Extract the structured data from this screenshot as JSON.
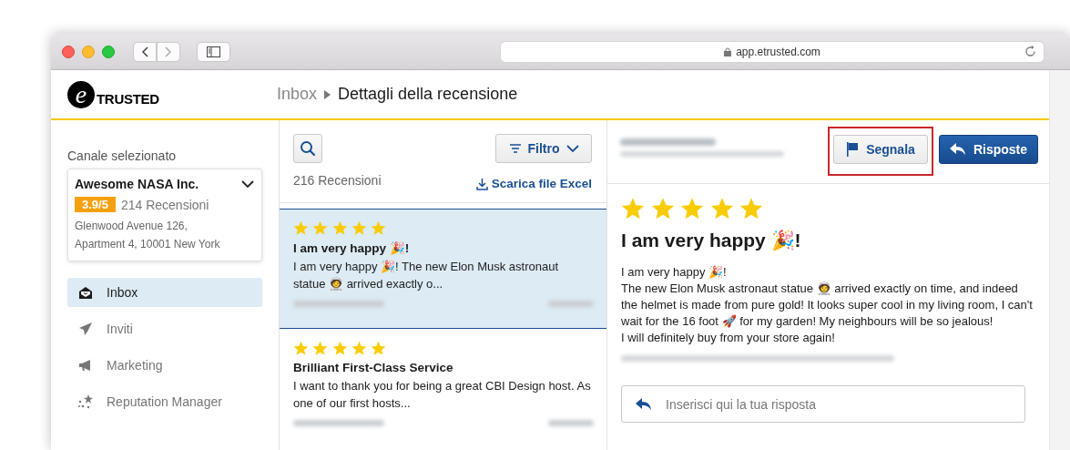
{
  "browser": {
    "url": "app.etrusted.com"
  },
  "header": {
    "logo_letter": "e",
    "logo_text": "TRUSTED",
    "breadcrumb": [
      {
        "label": "Inbox",
        "current": false
      },
      {
        "label": "Dettagli della recensione",
        "current": true
      }
    ]
  },
  "sidebar": {
    "channel_label": "Canale selezionato",
    "channel": {
      "name": "Awesome NASA Inc.",
      "rating": "3.9/5",
      "reviews": "214 Recensioni",
      "address_lines": [
        "Glenwood Avenue 126,",
        "Apartment 4, 10001 New York"
      ]
    },
    "items": [
      {
        "label": "Inbox",
        "selected": true
      },
      {
        "label": "Inviti",
        "selected": false
      },
      {
        "label": "Marketing",
        "selected": false
      },
      {
        "label": "Reputation Manager",
        "selected": false
      }
    ]
  },
  "list": {
    "filter_label": "Filtro",
    "count": "216 Recensioni",
    "download": "Scarica file Excel",
    "reviews": [
      {
        "stars": 5,
        "title": "I am very happy 🎉!",
        "excerpt": "I am very happy 🎉! The new Elon Musk astronaut statue 🧑‍🚀 arrived exactly o...",
        "selected": true
      },
      {
        "stars": 5,
        "title": "Brilliant First-Class Service",
        "excerpt": "I want to thank you for being a great CBI Design host. As one of our first hosts...",
        "selected": false
      }
    ]
  },
  "detail": {
    "flag_button": {
      "label": "Segnala",
      "highlighted": true
    },
    "reply_button": "Risposte",
    "stars": 5,
    "title": "I am very happy 🎉!",
    "body": "I am very happy 🎉!\nThe new Elon Musk astronaut statue 🧑‍🚀 arrived exactly on time, and indeed the helmet is made from pure gold! It looks super cool in my living room, I can't wait for the 16 foot 🚀 for my garden! My neighbours will be so jealous!\nI will definitely buy from your store again!",
    "reply": {
      "placeholder": "Inserisci qui la tua risposta"
    }
  }
}
